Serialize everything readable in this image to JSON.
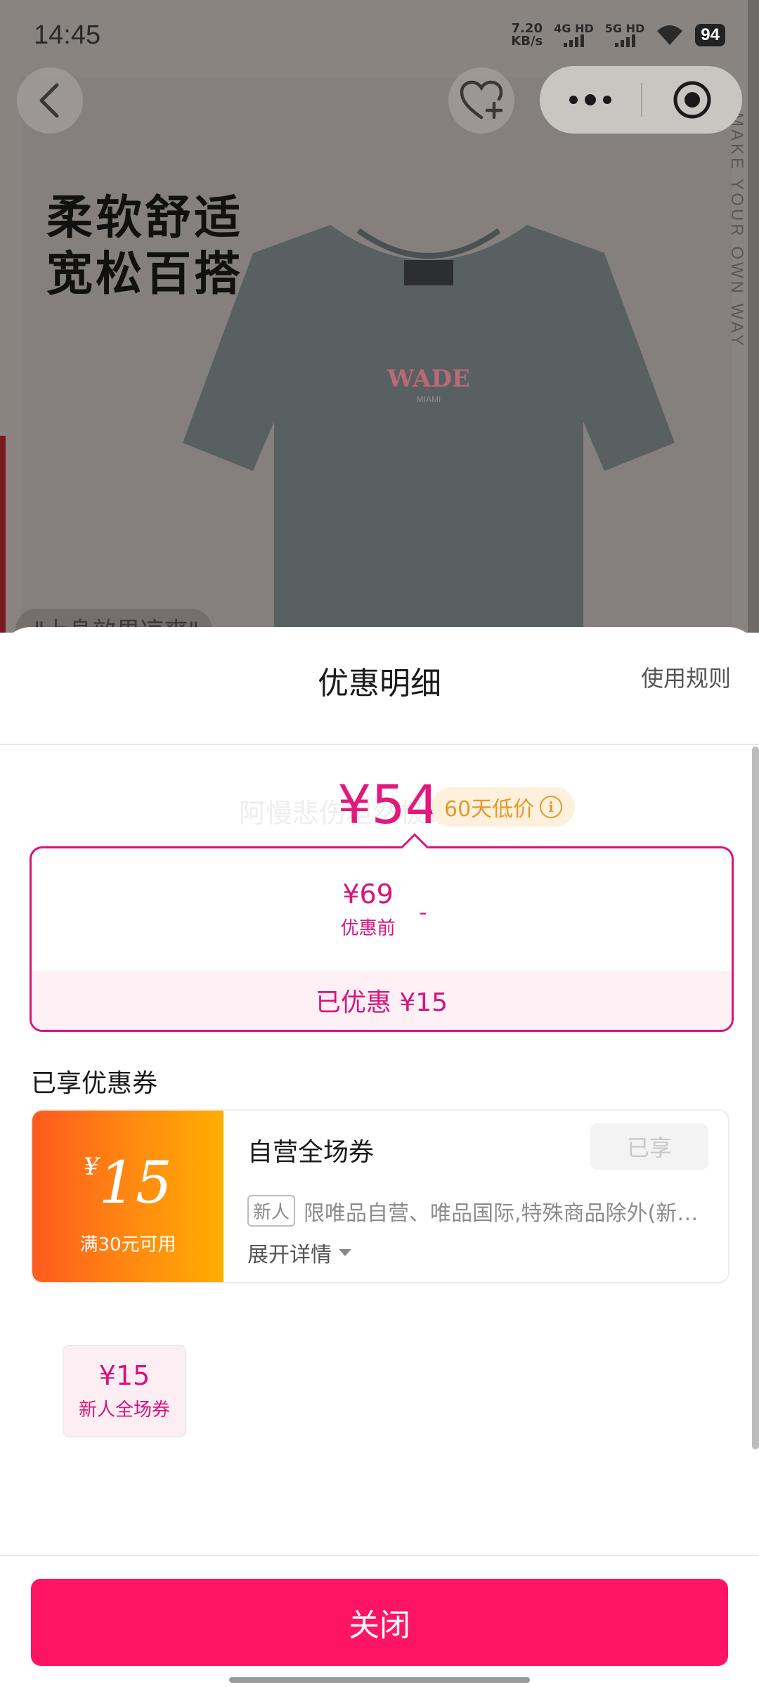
{
  "status_bar": {
    "time": "14:45",
    "net_speed_value": "7.20",
    "net_speed_unit": "KB/s",
    "sim1": "4G HD",
    "sim2": "5G HD",
    "battery": "94"
  },
  "background": {
    "headline_line1": "柔软舒适",
    "headline_line2": "宽松百搭",
    "shirt_brand": "WADE",
    "shirt_sub": "MIAMI",
    "tag_pill": "\"上身效果凉爽\"",
    "vertical_text": "MAKE YOUR OWN WAY"
  },
  "sheet": {
    "title": "优惠明细",
    "rules_link": "使用规则",
    "price_watermark": "阿慢悲伤坦然极致",
    "final_price": "¥54",
    "low_price_badge": "60天低价",
    "breakdown": {
      "original_amount": "¥69",
      "original_label": "优惠前",
      "operator": "-",
      "coupon_amount": "¥15",
      "coupon_label": "新人全场券",
      "total_saved": "已优惠 ¥15"
    },
    "section_title": "已享优惠券",
    "coupon": {
      "currency": "¥",
      "amount": "15",
      "condition": "满30元可用",
      "name": "自营全场券",
      "status": "已享",
      "tag": "新人",
      "description": "限唯品自营、唯品国际,特殊商品除外(新…",
      "expand_label": "展开详情"
    },
    "close_button": "关闭"
  },
  "colors": {
    "accent": "#e4177f",
    "button": "#ff1463",
    "coupon_gradient_start": "#ff5a1e",
    "coupon_gradient_end": "#ffad00",
    "badge_text": "#e49a2a"
  }
}
